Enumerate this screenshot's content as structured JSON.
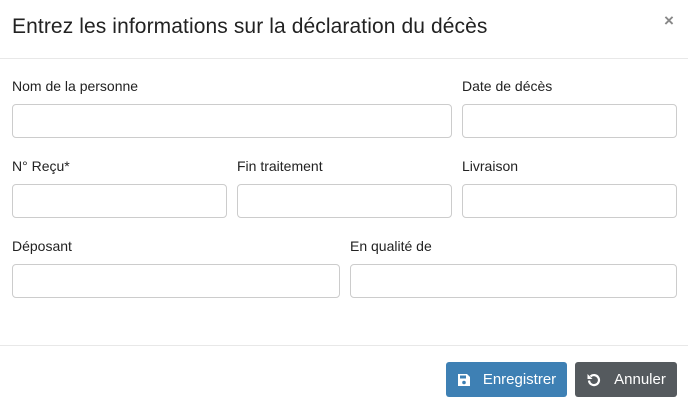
{
  "dialog": {
    "title": "Entrez les informations sur la déclaration du décès",
    "close_label": "×"
  },
  "fields": {
    "nom": {
      "label": "Nom de la personne",
      "value": ""
    },
    "date_deces": {
      "label": "Date de décès",
      "value": ""
    },
    "recu": {
      "label": "N° Reçu*",
      "value": ""
    },
    "fin_traitement": {
      "label": "Fin traitement",
      "value": ""
    },
    "livraison": {
      "label": "Livraison",
      "value": ""
    },
    "deposant": {
      "label": "Déposant",
      "value": ""
    },
    "qualite": {
      "label": "En qualité de",
      "value": ""
    }
  },
  "footer": {
    "save_label": "Enregistrer",
    "save_icon": "floppy-disk-icon",
    "cancel_label": "Annuler",
    "cancel_icon": "undo-icon",
    "save_color": "#3e80b4",
    "cancel_color": "#555a5e"
  }
}
